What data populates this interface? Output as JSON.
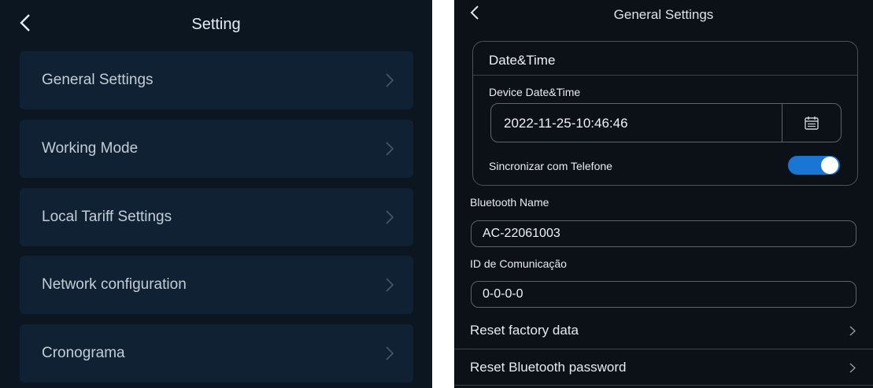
{
  "left": {
    "title": "Setting",
    "menu": [
      {
        "label": "General Settings"
      },
      {
        "label": "Working Mode"
      },
      {
        "label": "Local Tariff Settings"
      },
      {
        "label": "Network configuration"
      },
      {
        "label": "Cronograma"
      }
    ]
  },
  "right": {
    "title": "General Settings",
    "datetime_section": {
      "title": "Date&Time",
      "device_label": "Device Date&Time",
      "device_value": "2022-11-25-10:46:46",
      "sync_label": "Sincronizar com Telefone",
      "sync_enabled": true
    },
    "bluetooth_name": {
      "label": "Bluetooth Name",
      "value": "AC-22061003"
    },
    "comm_id": {
      "label": "ID de Comunicação",
      "value": "0-0-0-0"
    },
    "rows": [
      {
        "label": "Reset factory data"
      },
      {
        "label": "Reset Bluetooth password"
      }
    ]
  },
  "colors": {
    "left_background": "#0b1620",
    "left_item": "#0f2132",
    "right_background": "#0c1117",
    "toggle_on": "#1976d2"
  },
  "icons": [
    "back-arrow-icon",
    "chevron-right-icon",
    "calendar-icon"
  ]
}
